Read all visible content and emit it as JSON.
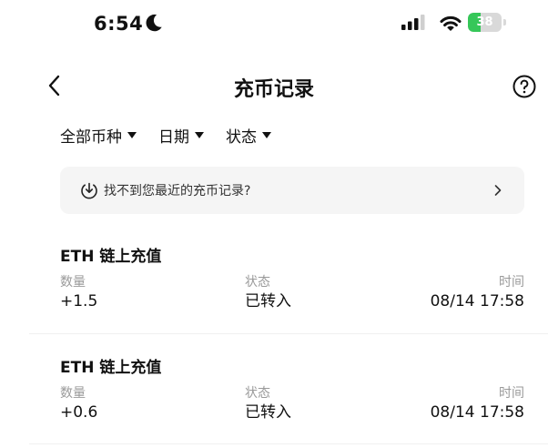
{
  "status_bar": {
    "time": "6:54",
    "battery": "38",
    "battery_level": 0.38
  },
  "nav": {
    "title": "充币记录"
  },
  "filters": [
    {
      "label": "全部币种"
    },
    {
      "label": "日期"
    },
    {
      "label": "状态"
    }
  ],
  "notice": {
    "text": "找不到您最近的充币记录?"
  },
  "columns": {
    "amount": "数量",
    "status": "状态",
    "time": "时间"
  },
  "records": [
    {
      "title": "ETH 链上充值",
      "amount": "+1.5",
      "status": "已转入",
      "time": "08/14 17:58"
    },
    {
      "title": "ETH 链上充值",
      "amount": "+0.6",
      "status": "已转入",
      "time": "08/14 17:58"
    }
  ],
  "colors": {
    "battery_green": "#36c759",
    "notice_bg": "#f5f5f5",
    "label_gray": "#9a9a9a"
  }
}
